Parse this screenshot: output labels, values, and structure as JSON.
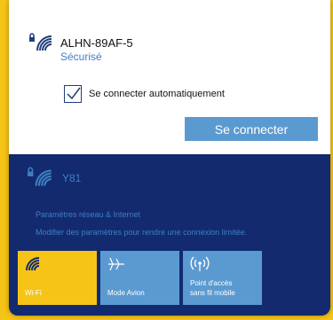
{
  "colors": {
    "accent": "#f6c416",
    "panel_dark": "#132a6f",
    "link": "#3e7fc1",
    "button": "#5b9ad1"
  },
  "current_network": {
    "name": "ALHN-89AF-5",
    "status": "Sécurisé",
    "icon": "secured-wifi-icon"
  },
  "auto_connect": {
    "label": "Se connecter automatiquement",
    "checked": true
  },
  "connect_button": {
    "label": "Se connecter"
  },
  "other_network": {
    "name": "Y81",
    "icon": "secured-wifi-icon"
  },
  "links": {
    "settings": "Paramètres réseau & Internet",
    "metered": "Modifier des paramètres pour rendre une connexion limitée."
  },
  "tiles": [
    {
      "label": "Wi-Fi",
      "icon": "wifi-icon",
      "active": true
    },
    {
      "label": "Mode Avion",
      "icon": "airplane-icon",
      "active": false
    },
    {
      "label": "Point d'accès\nsans fil mobile",
      "icon": "hotspot-icon",
      "active": false
    }
  ]
}
